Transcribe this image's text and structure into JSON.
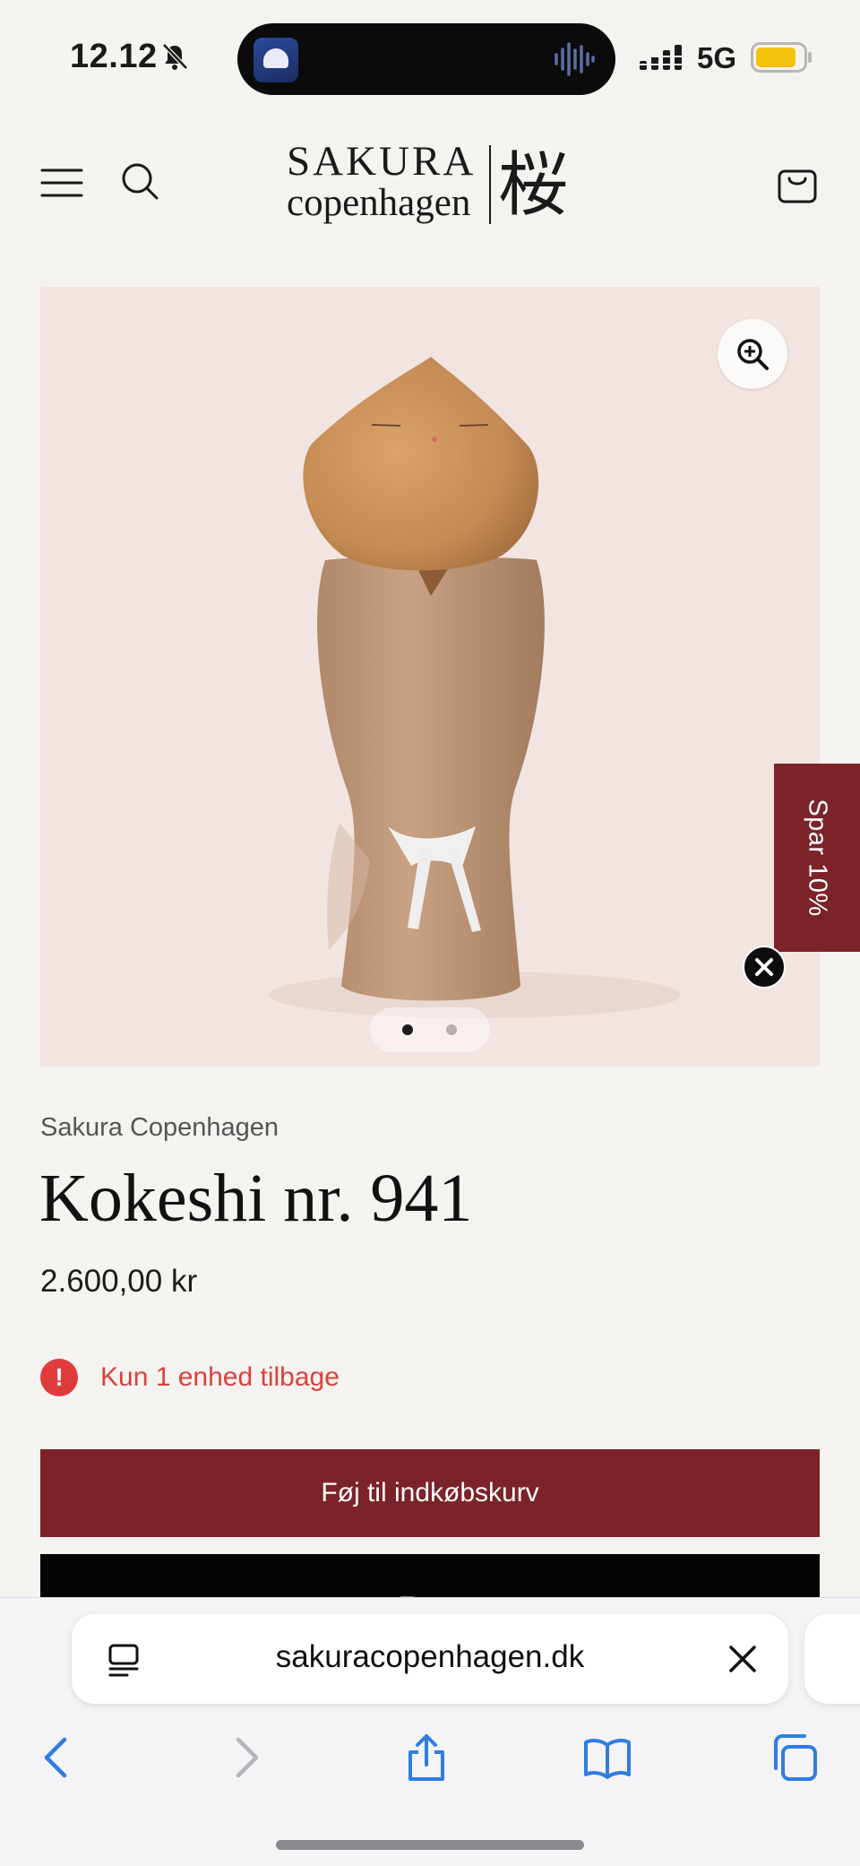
{
  "status_bar": {
    "time": "12.12",
    "network": "5G",
    "battery_color": "#f5c20b"
  },
  "header": {
    "logo_word": "SAKURA",
    "logo_sub": "copenhagen",
    "logo_kanji": "桜",
    "menu_icon": "hamburger-icon",
    "search_icon": "search-icon",
    "cart_icon": "shopping-bag-icon"
  },
  "gallery": {
    "image_count": 2,
    "active_index": 1
  },
  "promo_tab": {
    "label": "Spar 10%",
    "color": "#7c2329"
  },
  "product": {
    "vendor": "Sakura Copenhagen",
    "title": "Kokeshi nr. 941",
    "price": "2.600,00 kr",
    "stock_message": "Kun 1 enhed tilbage",
    "add_to_cart": "Føj til indkøbskurv",
    "buy_now_partial": "Pay"
  },
  "browser": {
    "url": "sakuracopenhagen.dk"
  },
  "colors": {
    "accent": "#7c2329",
    "alert": "#e03b3b",
    "ios_blue": "#2f7de1"
  }
}
